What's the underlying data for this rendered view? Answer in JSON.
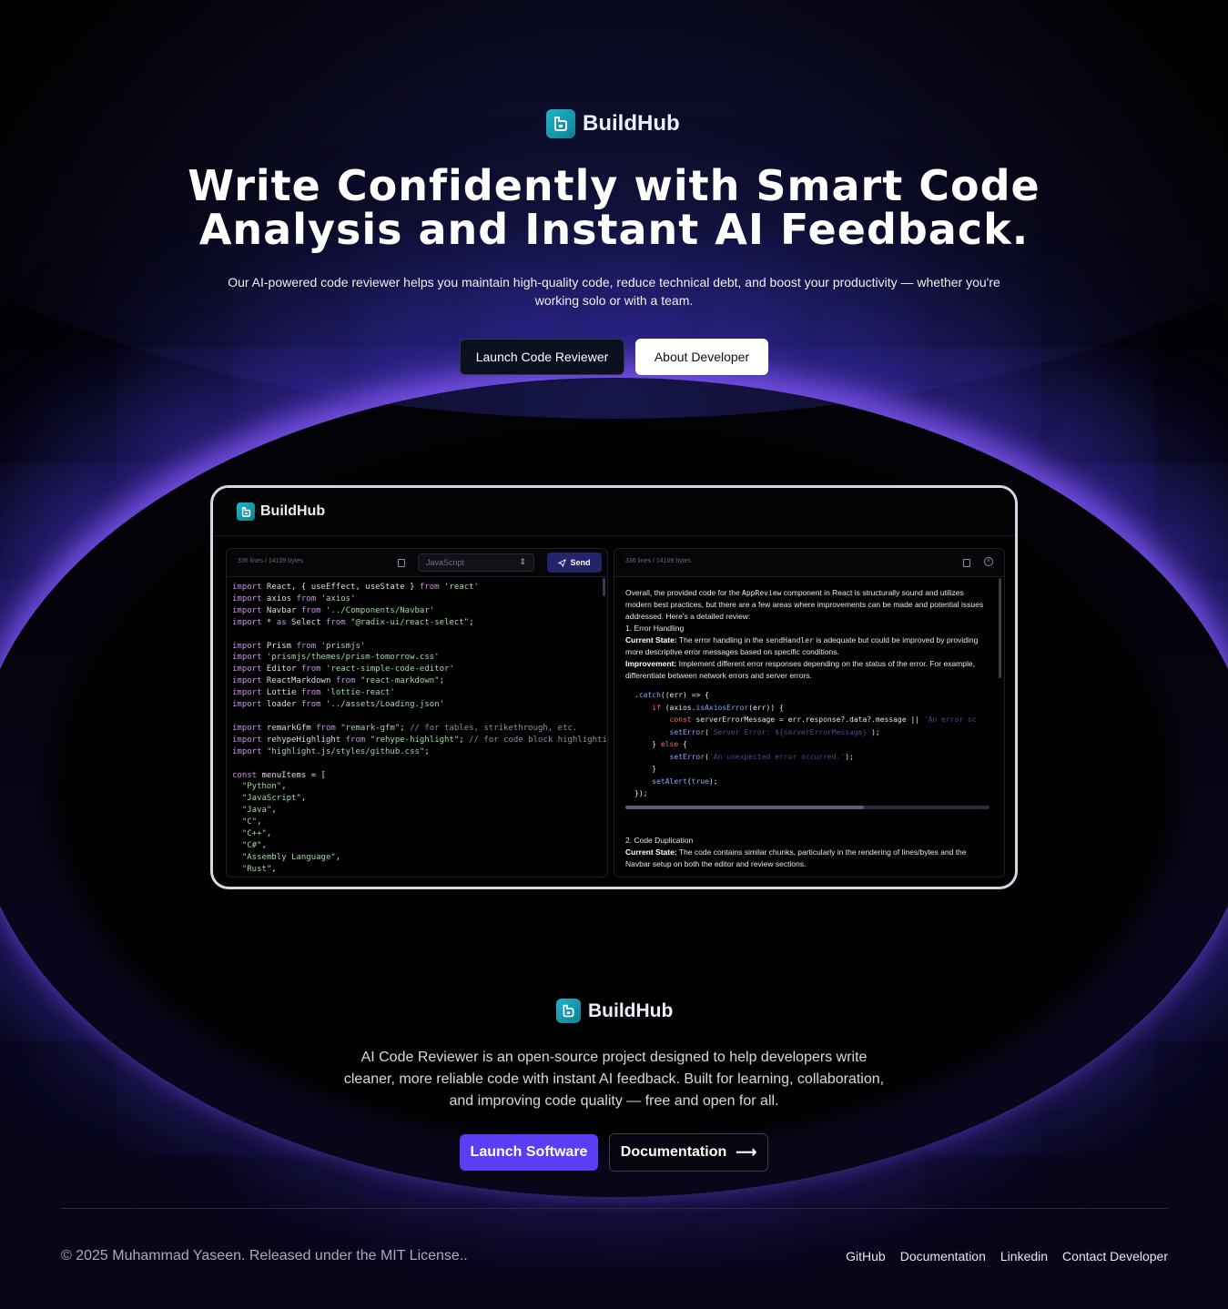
{
  "brand": {
    "name": "BuildHub",
    "accent": "#1db5c9"
  },
  "hero": {
    "title_line1": "Write Confidently with Smart Code",
    "title_line2": "Analysis and Instant AI Feedback.",
    "subtitle": "Our AI-powered code reviewer helps you maintain high-quality code, reduce technical debt, and boost your productivity — whether you're working solo or with a team.",
    "launch_label": "Launch Code Reviewer",
    "about_label": "About Developer"
  },
  "preview": {
    "editor": {
      "meta": "336 lines  /  14109 bytes",
      "language": "JavaScript",
      "send_label": "Send"
    },
    "review": {
      "meta": "336 lines  /  14109 bytes",
      "intro_a": "Overall, the provided code for the ",
      "intro_code": "AppReview",
      "intro_b": " component in React is structurally sound and utilizes modern best practices, but there are a few areas where improvements can be made and potential issues addressed. Here's a detailed review:",
      "section1_title": "1. Error Handling",
      "current_state_label": "Current State:",
      "s1_state_a": " The error handling in the ",
      "s1_state_code": "sendHandler",
      "s1_state_b": " is adequate but could be improved by providing more descriptive error messages based on specific conditions.",
      "improvement_label": "Improvement:",
      "s1_improvement": " Implement different error responses depending on the status of the error. For example, differentiate between network errors and server errors.",
      "section2_title": "2. Code Duplication",
      "s2_state": " The code contains similar chunks, particularly in the rendering of lines/bytes and the Navbar setup on both the editor and review sections."
    }
  },
  "about": {
    "text": "AI Code Reviewer is an open-source project designed to help developers write cleaner, more reliable code with instant AI feedback. Built for learning, collaboration, and improving code quality — free and open for all.",
    "launch_label": "Launch Software",
    "docs_label": "Documentation",
    "docs_arrow": "⟶"
  },
  "footer": {
    "copyright": "© 2025 Muhammad Yaseen. Released under the MIT License..",
    "links": [
      "GitHub",
      "Documentation",
      "Linkedin",
      "Contact Developer"
    ]
  }
}
